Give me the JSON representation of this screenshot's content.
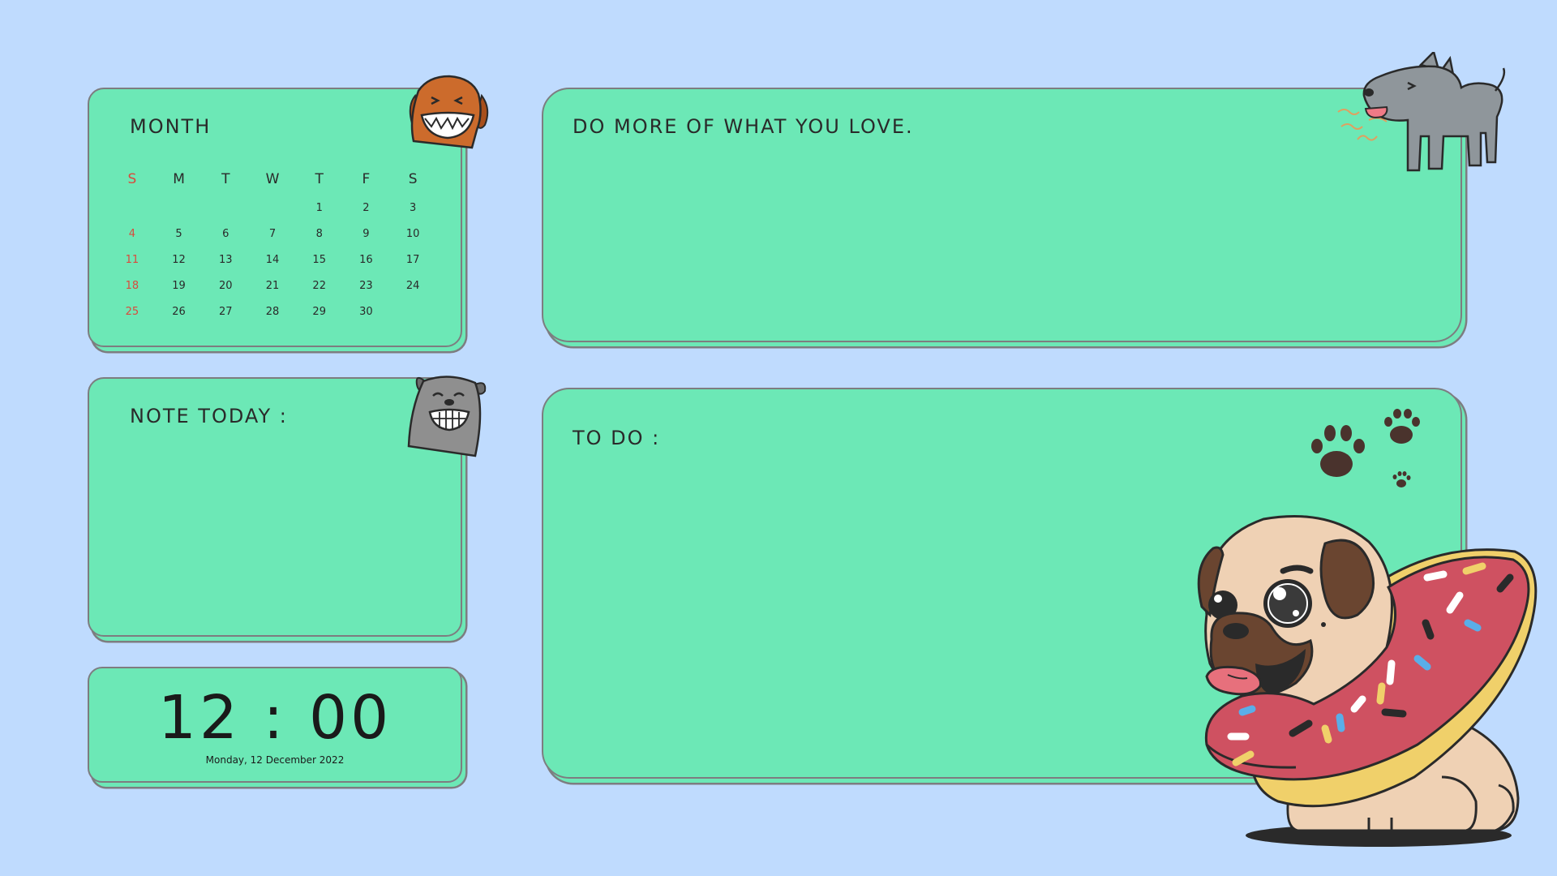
{
  "calendar": {
    "title": "MONTH",
    "weekdays": [
      "S",
      "M",
      "T",
      "W",
      "T",
      "F",
      "S"
    ],
    "days": [
      "",
      "",
      "",
      "",
      "1",
      "2",
      "3",
      "4",
      "5",
      "6",
      "7",
      "8",
      "9",
      "10",
      "11",
      "12",
      "13",
      "14",
      "15",
      "16",
      "17",
      "18",
      "19",
      "20",
      "21",
      "22",
      "23",
      "24",
      "25",
      "26",
      "27",
      "28",
      "29",
      "30",
      ""
    ]
  },
  "note": {
    "title": "NOTE TODAY :"
  },
  "clock": {
    "time": "12 : 00",
    "date": "Monday, 12 December 2022"
  },
  "quote": {
    "title": "DO MORE OF WHAT YOU LOVE."
  },
  "todo": {
    "title": "TO DO :"
  },
  "colors": {
    "background": "#bfdbfe",
    "card": "#6ce8b6",
    "border": "#7d7d80",
    "sunday": "#d94a3d"
  },
  "decorations": [
    "orange-dog-icon",
    "gray-dog-icon",
    "barking-dog-icon",
    "paw-print-icon",
    "pug-with-donut-icon"
  ]
}
